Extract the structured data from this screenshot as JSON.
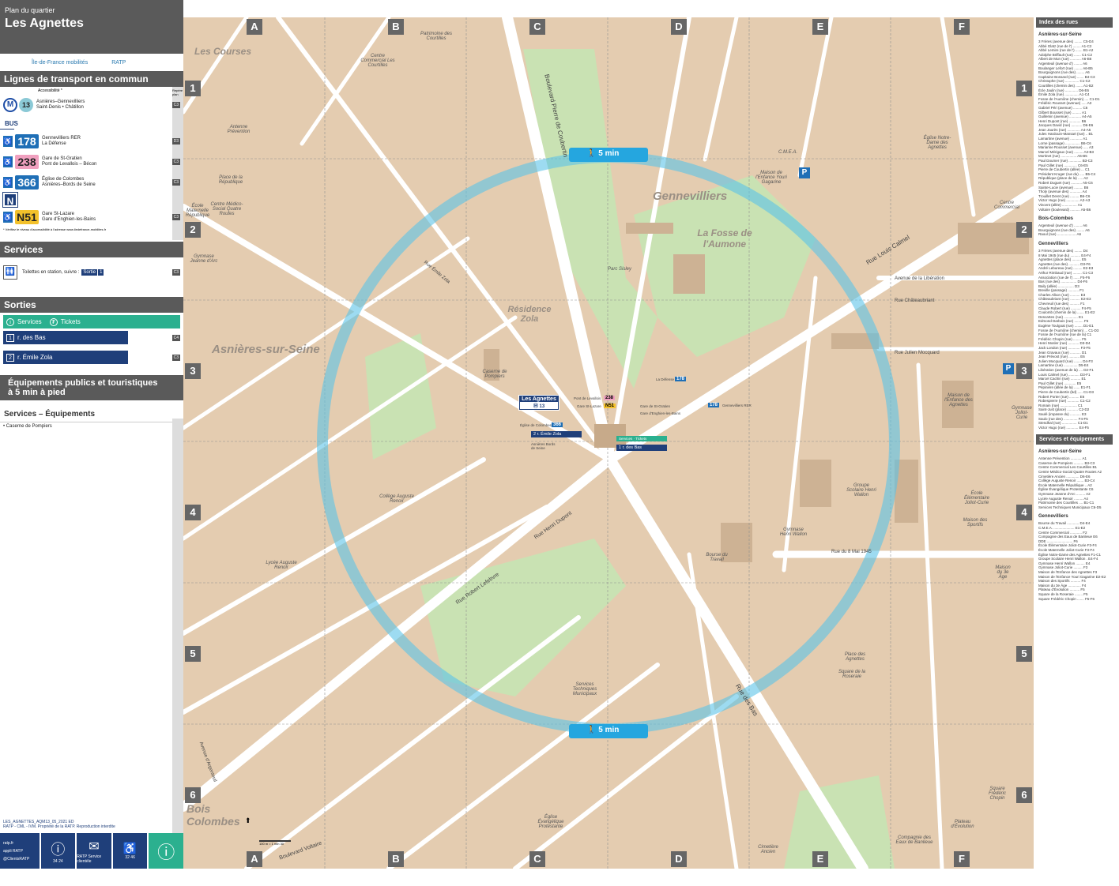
{
  "header": {
    "subtitle": "Plan du quartier",
    "title": "Les Agnettes"
  },
  "logos": {
    "idfm": "Île-de-France mobilités",
    "ratp": "RATP"
  },
  "transport": {
    "section_title": "Lignes de transport en commun",
    "access_label": "Accessibilité *",
    "plan_col": "Repère plan",
    "metro": {
      "line": "13",
      "desc1": "Asnières–Gennevilliers",
      "desc2": "Saint-Denis • Châtillon",
      "ref": "C3"
    },
    "bus_label": "BUS",
    "buses": [
      {
        "num": "178",
        "color": "#1f6fb6",
        "d1": "Gennevilliers RER",
        "d2": "La Défense",
        "ref": "D3"
      },
      {
        "num": "238",
        "color": "#f0a0bf",
        "d1": "Gare de St-Gratien",
        "d2": "Pont de Levallois – Bécon",
        "ref": "C3"
      },
      {
        "num": "366",
        "color": "#1f6fb6",
        "d1": "Église de Colombes",
        "d2": "Asnières–Bords de Seine",
        "ref": "C3"
      }
    ],
    "noctilien_icon": "N",
    "night": {
      "num": "N51",
      "color": "#f3c12b",
      "d1": "Gare St-Lazare",
      "d2": "Gare d'Enghien-les-Bains",
      "ref": "C3"
    },
    "note": "* Vérifiez le niveau d'accessibilité à l'adresse www.iledefrance-mobilites.fr"
  },
  "services": {
    "title": "Services",
    "toilets": "Toilettes en station, suivre :",
    "exit_tag": "Sortie",
    "exit_num": "1",
    "ref": "C3"
  },
  "sorties": {
    "title": "Sorties",
    "services_label": "Services",
    "tickets_label": "Tickets",
    "exits": [
      {
        "num": "1",
        "name": "r. des Bas",
        "ref": "C4"
      },
      {
        "num": "2",
        "name": "r. Émile Zola",
        "ref": "C3"
      }
    ]
  },
  "equipements": {
    "title1": "Équipements publics et touristiques",
    "title2": "à 5 min à pied",
    "sub": "Services – Équipements",
    "item": "• Caserne de Pompiers",
    "ref": "C3"
  },
  "footer": {
    "code": "LES_AGNETTES_AQM13_05_2021 ED",
    "rights": "RATP - CML - IVM. Propriété de la RATP. Reproduction interdite",
    "ratp_fr": "ratp.fr",
    "app": "appli RATP",
    "twitter": "@ClientsRATP",
    "phone1": "34 24",
    "phone2": "32 46",
    "mail": "RATP Service clientèle"
  },
  "map": {
    "cols": [
      "A",
      "B",
      "C",
      "D",
      "E",
      "F"
    ],
    "rows": [
      "1",
      "2",
      "3",
      "4",
      "5",
      "6"
    ],
    "walk": "5 min",
    "areas": [
      "Les Courses",
      "Gennevilliers",
      "La Fosse de l'Aumone",
      "Résidence Zola",
      "Asnières-sur-Seine",
      "Bois Colombes"
    ],
    "station": {
      "name": "Les Agnettes",
      "line": "13"
    },
    "exit1": "r. des Bas",
    "exit2": "r. Émile Zola",
    "stops": {
      "colombes": "Église de Colombes",
      "asnieres": "Asnières Bords de Seine",
      "levallois": "Pont de Levallois",
      "stlazare": "Gare St-Lazare",
      "stgratien": "Gare de St-Gratien",
      "enghien": "Gare d'Enghien-les-Bains",
      "defense": "La Défense",
      "rer": "Gennevilliers RER"
    },
    "places": [
      "Patrimoine des Courtilles",
      "Centre Commercial Les Courtilles",
      "Antenne Prévention",
      "Place de la République",
      "Centre Médico-Social Quatre Routes",
      "École Maternelle République",
      "Gymnase Jeanne d'Arc",
      "Caserne de Pompiers",
      "Collège Auguste Renoir",
      "Lycée Auguste Renoir",
      "Services Techniques Municipaux",
      "Église Évangélique Protestante",
      "Cimetière Ancien",
      "Compagnie des Eaux de Banlieue",
      "Plateau d'Évolution",
      "Square Frédéric Chopin",
      "Square de la Roseraie",
      "Place des Agnettes",
      "Gymnase Henri Wallon",
      "Groupe Scolaire Henri Wallon",
      "École Élémentaire Joliot-Curie",
      "Maison des Sportifs",
      "Maison du 3e Âge",
      "Gymnase Joliot-Curie",
      "Centre Commercial",
      "Maison de l'Enfance des Agnettes",
      "Église Notre-Dame des Agnettes",
      "C.M.E.A.",
      "Maison de l'Enfance Youri Gagarine",
      "Bourse du Travail",
      "Parc Sisley"
    ],
    "streets": [
      "Boulevard Pierre de Coubertin",
      "Rue Louis Calmel",
      "Avenue de la Libération",
      "Rue Henri Dupont",
      "Rue Robert Lefebvre",
      "Rue des Bas",
      "Rue du 8 Mai 1945",
      "Boulevard Voltaire",
      "Avenue d'Argenteuil",
      "Rue Émile Zola",
      "Rue Julien Mocquard",
      "Rue Châteaubriant"
    ],
    "scale": "100 m = 1 min 30"
  },
  "index": {
    "title": "Index des rues",
    "asnieres_title": "Asnières-sur-Seine",
    "asnieres": [
      "3 Frères (avenue des) ........ C5-D4",
      "Abbé Glatz (rue de l') ........ A1-C2",
      "Abbé Lemire (rue de l') ....... B1-A2",
      "Adolphe Briffault (rue) ....... C1-C2",
      "Albert de Mun (rue) ........... A6-B6",
      "Argenteuil (avenue d') ........ A6",
      "Boulanger Lefort (rue) ........ A6-B5",
      "Bourguignons (rue des) ........ A6",
      "Capitaine Bossard (rue) ....... B4-C3",
      "Christophe (rue) .............. C1-C2",
      "Courtilles (chemin des) ....... A1-B2",
      "Écle Jaulin (rue) ............. D6-E6",
      "Émile Zola (rue) .............. A1-C4",
      "Fosse de l'Aumône (chemin) .... C1-D1",
      "Frédéric Rousset (avenue) ..... A3",
      "Gabriel Péri (avenue) ......... C6",
      "Gilbert Bousset (rue) ......... A1",
      "Guillemin (avenue) ............ A4-A5",
      "Henri Dupont (rue) ............ B6",
      "Jacques David (rue) ........... D6-E6",
      "Jean Jaurès (rue) ............. A4-A5",
      "Jules Hardouin-Mansart (rue) .. B1",
      "Lamartine (avenue) ............ A1",
      "Lorne (passage) ............... B6-C6",
      "Marianne Rousset (avenue) ..... A3",
      "Marcel Mérigaux (rue) ......... A3-B3",
      "Mortinet (rue) ................ A6-B5",
      "Paul Doumer (rue) ............. B3-C3",
      "Paul Gillet (rue) ............. C6-E5",
      "Pierre de Coubertin (allée) ... C1",
      "Président Kruger (rue du) ..... B5-C4",
      "République (place de la) ..... A2",
      "Robert Duguet (rue) ........... A5-C6",
      "Sainte-Lucie (avenue) ......... B6",
      "Tholy (avenue des) ............ A4",
      "Trouillet Deret (rue) ......... B6-C6",
      "Victor Hugo (rue) ............. A2-A3",
      "Vincent (allée) ............... A1",
      "Voltaire (boulevard) .......... A5-B6"
    ],
    "bois_title": "Bois-Colombes",
    "bois": [
      "Argenteuil (avenue d') ........ A6",
      "Bourguignons (rue des) ........ A6",
      "Raoul (rue) ................... A6"
    ],
    "genn_title": "Gennevilliers",
    "genn": [
      "3 Frères (avenue des) ........ D4",
      "8 Mai 1945 (rue du) .......... E4-F4",
      "Agnettes (place des) ......... E5",
      "Agnettes (rue des) ........... D3-F6",
      "André Lebureau (rue) ......... E2-E3",
      "Arthur Rimbaud (rue) ......... C1-C3",
      "Association (rue de l') ...... F5-F6",
      "Bas (rue des) ................ D4-F6",
      "Baily (allée) ................ D3",
      "Breville (passage) ........... F1",
      "Charles Albon (rue) .......... E3",
      "Châteaubriant (rue) .......... E2-E3",
      "Chevreuil (rue des) .......... F1",
      "Claude Robert (rue) .......... F4-F5",
      "Coulomb (chemin de la) ....... E1-E2",
      "Descartes (rue) .............. E1",
      "Edmond Darbois (rue) ......... F5",
      "Eugène Toulgoat (rue) ........ D1-E1",
      "Fosse de l'Aumône (chemin) ... C1-D3",
      "Fosse de l'Aumône (rue de la)  C1",
      "Frédéric Chopin (rue) ........ F5",
      "Henri Mosler (rue) ........... D3-D4",
      "Jack London (rue) ............ F3-F5",
      "Jean Gravaux (rue) ........... D1",
      "Jean Prévost (rue) ........... E6",
      "Julien Mocquard (rue) ........ D4-F3",
      "Lamartine (rue) .............. D5-E4",
      "Libération (avenue de la) .... D2-F1",
      "Louis Calmel (rue) ........... D3-F1",
      "Marcel Cachin (rue) .......... E1",
      "Paul Gillet (rue) ............ E5",
      "Pépinière (allée de la) ...... E1-F1",
      "Pierre de Coubertin (bd) ..... C1-D3",
      "Robert Porter (rue) .......... E6",
      "Robespierre (rue) ............ C1-C2",
      "Romain (rue) ................. C1",
      "Saint-Just (place) ........... C2-D2",
      "Saulé (impasse du) ........... E3",
      "Saulo (rue des) .............. F4-F5",
      "Stendhal (rue) ............... C1-D1",
      "Victor Hugo (rue) ............ E4-F5"
    ],
    "serv_title": "Services et équipements",
    "serv_asn_title": "Asnières-sur-Seine",
    "serv_asn": [
      "Antenne Prévention ........... A1",
      "Caserne de Pompiers .......... B3-C3",
      "Centre Commercial Les Courtilles  B1",
      "Centre Médico-Social Quatre Routes A2",
      "Cimetière Ancien ............. D6-E6",
      "Collège Auguste Renoir ....... B3-C4",
      "École Maternelle République .. A2",
      "Église Évangélique Protestante C6",
      "Gymnase Jeanne d'Arc ......... A2",
      "Lycée Auguste Renoir ......... A4",
      "Patrimoine des Courtilles .... B1-C1",
      "Services Techniques Municipaux C6-D5"
    ],
    "serv_gen_title": "Gennevilliers",
    "serv_gen": [
      "Bourse du Travail ............ D4-E4",
      "C.M.E.A. ..................... E1-E2",
      "Centre Commercial ............ F2",
      "Compagnie des Eaux de Banlieue E6",
      "DDE .......................... F6",
      "École Élémentaire Joliot-Curie F3-F4",
      "École Maternelle Joliot-Curie  F3-F4",
      "Église Notre-Dame des Agnettes F1-C1",
      "Groupe Scolaire Henri Wallon . E4-F4",
      "Gymnase Henri Wallon ......... E4",
      "Gymnase Joliot-Curie ......... F3",
      "Maison de l'Enfance des Agnettes F3",
      "Maison de l'Enfance Youri Gagarine D2-E2",
      "Maison des Sportifs .......... F4",
      "Maison du 3e Âge ............. F4",
      "Plateau d'Évolution .......... F5",
      "Square de la Roseraie ........ F5",
      "Square Frédéric Chopin ....... F5-F6"
    ]
  },
  "colors": {
    "water": "#a9dbe3",
    "circle": "#5cc3e8",
    "park": "#c9e2b3",
    "road": "#ffffff",
    "block": "#e4ccb0",
    "accent": "#1f3f7a"
  }
}
